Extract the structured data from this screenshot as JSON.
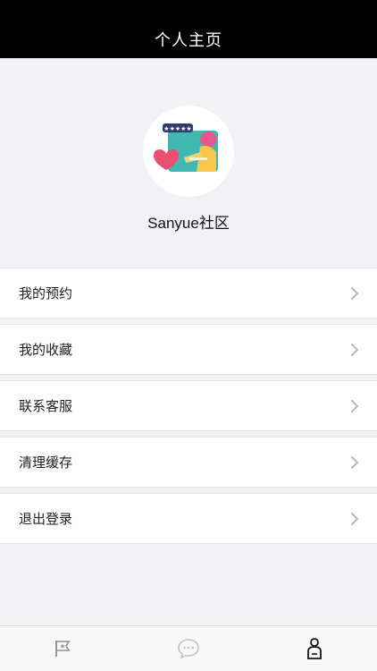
{
  "header": {
    "title": "个人主页"
  },
  "profile": {
    "name": "Sanyue社区"
  },
  "menu": {
    "items": [
      {
        "label": "我的预约"
      },
      {
        "label": "我的收藏"
      },
      {
        "label": "联系客服"
      },
      {
        "label": "清理缓存"
      },
      {
        "label": "退出登录"
      }
    ]
  },
  "tabbar": {
    "tabs": [
      {
        "icon": "flag-icon"
      },
      {
        "icon": "chat-bubble-icon"
      },
      {
        "icon": "person-icon",
        "active": true
      }
    ]
  },
  "colors": {
    "nav_background": "#000000",
    "page_background": "#f2f2f6",
    "card_background": "#ffffff",
    "chevron": "#b8b8bd"
  }
}
